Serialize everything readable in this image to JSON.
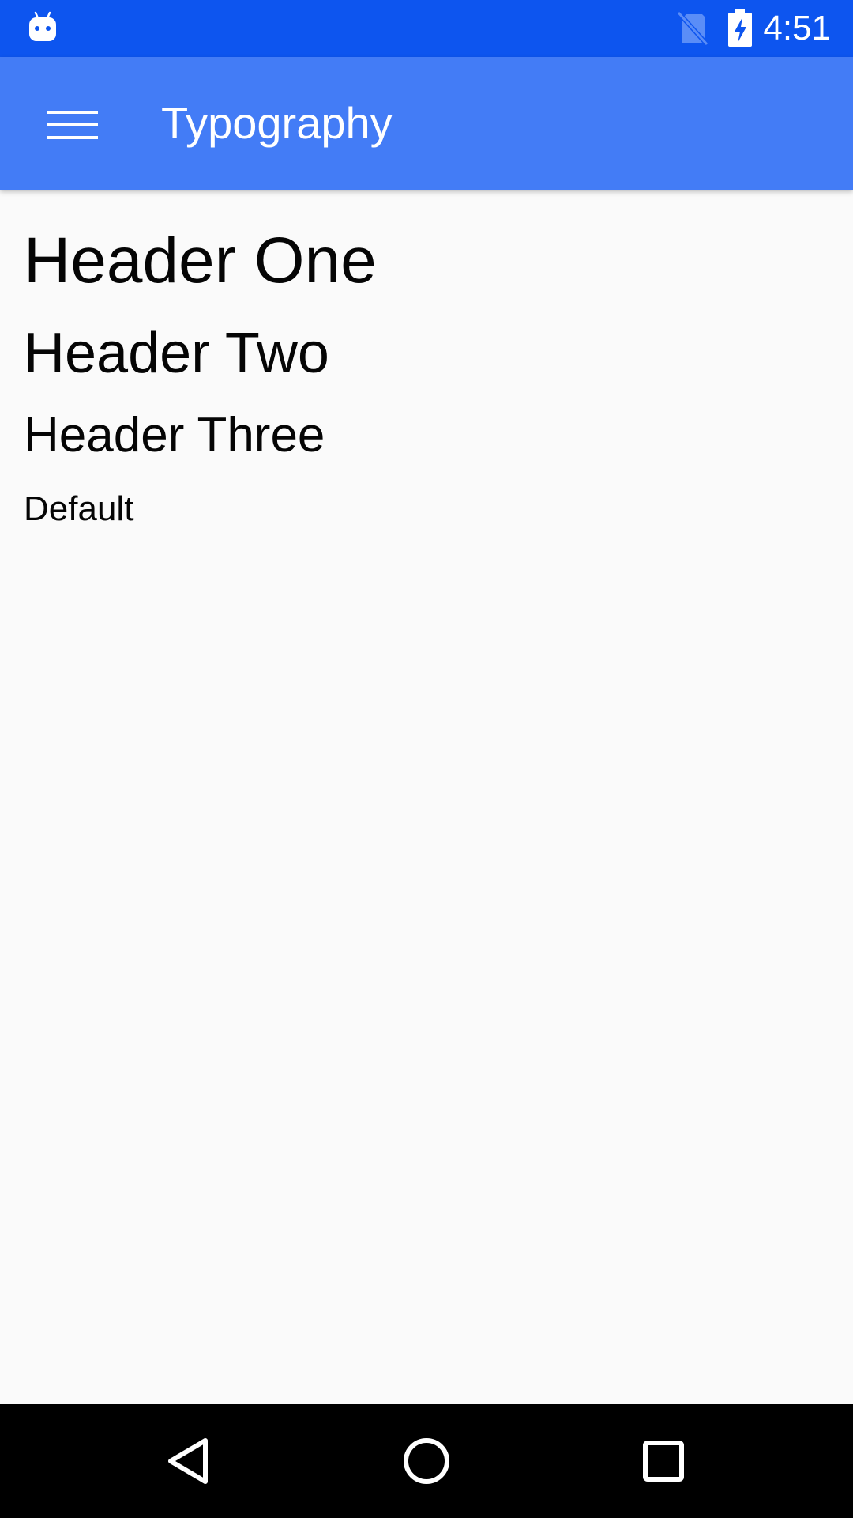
{
  "status_bar": {
    "time": "4:51",
    "background_color": "#0d55ef",
    "icons": [
      "android-notification-icon",
      "no-sim-icon",
      "battery-charging-icon"
    ]
  },
  "app_bar": {
    "title": "Typography",
    "background_color": "#437cf6",
    "menu_icon": "hamburger-menu-icon"
  },
  "content": {
    "header_one": "Header One",
    "header_two": "Header Two",
    "header_three": "Header Three",
    "default_text": "Default"
  },
  "nav_bar": {
    "buttons": [
      "back-icon",
      "home-icon",
      "recents-icon"
    ]
  }
}
